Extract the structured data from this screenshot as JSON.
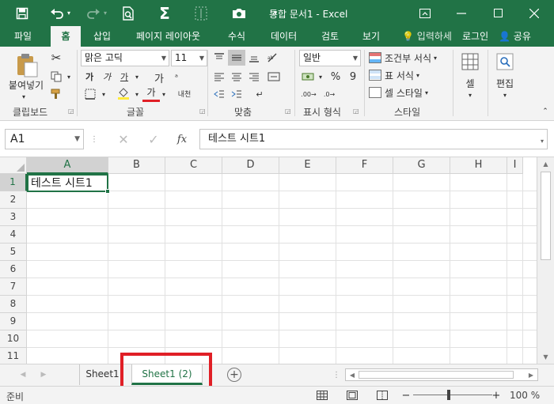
{
  "titlebar": {
    "title": "통합 문서1 - Excel",
    "icons": [
      "save-icon",
      "undo-icon",
      "redo-icon",
      "print-preview-icon",
      "autosum-icon",
      "touch-mode-icon",
      "customize-icon"
    ]
  },
  "ribbon_tabs": {
    "file": "파일",
    "home": "홈",
    "insert": "삽입",
    "layout": "페이지 레이아웃",
    "formulas": "수식",
    "data": "데이터",
    "review": "검토",
    "view": "보기",
    "tell": "입력하세",
    "signin": "로그인",
    "share": "공유"
  },
  "ribbon": {
    "clipboard": {
      "label": "클립보드",
      "paste": "붙여넣기"
    },
    "font": {
      "label": "글꼴",
      "name": "맑은 고딕",
      "size": "11",
      "bold": "가",
      "italic": "가",
      "underline": "가",
      "grow": "가",
      "font_color": "가",
      "phonetic": "내천"
    },
    "alignment": {
      "label": "맞춤"
    },
    "number": {
      "label": "표시 형식",
      "format": "일반",
      "percent": "%",
      "comma": "9"
    },
    "styles": {
      "label": "스타일",
      "conditional": "조건부 서식",
      "table": "표 서식",
      "cell_styles": "셀 스타일"
    },
    "cells": {
      "label": "셀"
    },
    "editing": {
      "label": "편집"
    }
  },
  "formula_bar": {
    "name_box": "A1",
    "content": "테스트 시트1",
    "fx": "fx"
  },
  "grid": {
    "columns": [
      "A",
      "B",
      "C",
      "D",
      "E",
      "F",
      "G",
      "H",
      "I"
    ],
    "rows": [
      "1",
      "2",
      "3",
      "4",
      "5",
      "6",
      "7",
      "8",
      "9",
      "10",
      "11"
    ],
    "cell_a1": "테스트 시트1"
  },
  "sheets": {
    "tabs": [
      "Sheet1",
      "Sheet1 (2)"
    ],
    "active": "Sheet1 (2)",
    "add": "+"
  },
  "status": {
    "ready": "준비",
    "zoom": "100 %",
    "minus": "−",
    "plus": "+"
  },
  "colors": {
    "accent": "#217346",
    "highlight": "#e01f26"
  }
}
